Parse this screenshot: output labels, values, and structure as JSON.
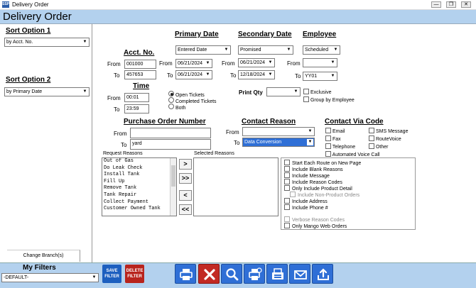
{
  "window": {
    "title": "Delivery Order",
    "app_icon": "SSP",
    "min": "—",
    "max": "❐",
    "close": "✕"
  },
  "header": {
    "title": "Delivery Order"
  },
  "left": {
    "sort1_label": "Sort Option 1",
    "sort1_value": "by Acct. No.",
    "sort2_label": "Sort Option 2",
    "sort2_value": "by Primary Date",
    "change_branch": "Change Branch(s)"
  },
  "acct": {
    "label": "Acct. No.",
    "from_label": "From",
    "from_value": "001000",
    "to_label": "To",
    "to_value": "457653"
  },
  "time": {
    "label": "Time",
    "from_label": "From",
    "from_value": "00:01",
    "to_label": "To",
    "to_value": "23:59"
  },
  "tickets": {
    "open": "Open Tickets",
    "completed": "Completed Tickets",
    "both": "Both"
  },
  "primary": {
    "label": "Primary Date",
    "type": "Entered Date",
    "from_label": "From",
    "from_value": "06/21/2024",
    "to_label": "To",
    "to_value": "06/21/2024"
  },
  "secondary": {
    "label": "Secondary Date",
    "type": "Promised",
    "from_label": "From",
    "from_value": "06/21/2024",
    "to_label": "To",
    "to_value": "12/18/2024"
  },
  "employee": {
    "label": "Employee",
    "type": "Scheduled",
    "from_label": "From",
    "from_value": "",
    "to_label": "To",
    "to_value": "YY01"
  },
  "print": {
    "label": "Print Qty",
    "value": "",
    "exclusive": "Exclusive",
    "group": "Group by Employee"
  },
  "po": {
    "label": "Purchase Order Number",
    "from_label": "From",
    "from_value": "",
    "to_label": "To",
    "to_value": "yard"
  },
  "contact_reason": {
    "label": "Contact Reason",
    "from_label": "From",
    "from_value": "",
    "to_label": "To",
    "to_value": "Data Conversion"
  },
  "contact_via": {
    "label": "Contact Via Code",
    "items": [
      "Email",
      "Fax",
      "Telephone",
      "Automated Voice Call",
      "SMS Message",
      "RouteVoice",
      "Other"
    ]
  },
  "reasons": {
    "request_label": "Request Reasons",
    "selected_label": "Selected Reasons",
    "items": [
      "Out of Gas",
      "Do Leak Check",
      "Install Tank",
      "Fill Up",
      "Remove Tank",
      "Tank Repair",
      "Collect Payment",
      "Customer Owned Tank"
    ],
    "move_right": ">",
    "move_all_right": ">>",
    "move_left": "<",
    "move_all_left": "<<"
  },
  "options": [
    "Start Each Route on New Page",
    "Include Blank Reasons",
    "Include Message",
    "Include Reason Codes",
    "Only Include Product Detail",
    "Include Non-Product Orders",
    "Include Address",
    "Include Phone #",
    "Verbose Reason Codes",
    "Only Mango Web Orders"
  ],
  "footer": {
    "my_filters": "My Filters",
    "filter_value": "-DEFAULT-",
    "save_filter": [
      "SAVE",
      "FILTER"
    ],
    "delete_filter": [
      "DELETE",
      "FILTER"
    ]
  },
  "colors": {
    "header_bg": "#b3d1ee",
    "button_blue": "#2f6fd6",
    "button_red": "#c22a24",
    "save_blue": "#1d5fbf",
    "delete_red": "#b8241d"
  },
  "toolbar_icons": [
    "print-icon",
    "cancel-icon",
    "search-icon",
    "print-preview-icon",
    "fax-icon",
    "email-icon",
    "export-icon"
  ]
}
